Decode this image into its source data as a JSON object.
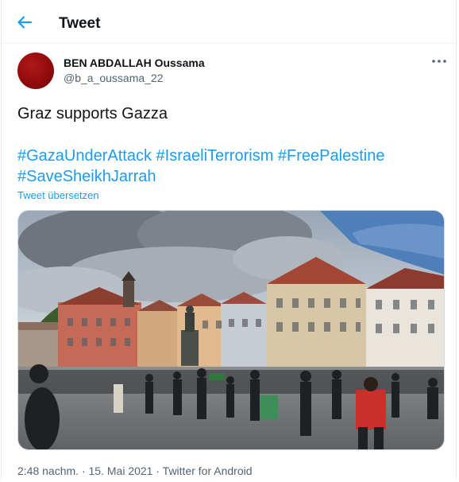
{
  "header": {
    "title": "Tweet",
    "back_icon": "arrow-left-icon"
  },
  "author": {
    "name": "BEN ABDALLAH Oussama",
    "handle": "@b_a_oussama_22",
    "avatar_color": "#8e0b0b"
  },
  "tweet": {
    "text": "Graz supports Gazza",
    "hashtags": [
      "#GazaUnderAttack",
      "#IsraeliTerrorism",
      "#FreePalestine",
      "#SaveSheikhJarrah"
    ],
    "translate_label": "Tweet übersetzen",
    "time": "2:48 nachm.",
    "separator": " · ",
    "date": "15. Mai 2021",
    "source": "Twitter for Android"
  },
  "colors": {
    "link": "#1d9bf0",
    "secondary_text": "#536471"
  }
}
